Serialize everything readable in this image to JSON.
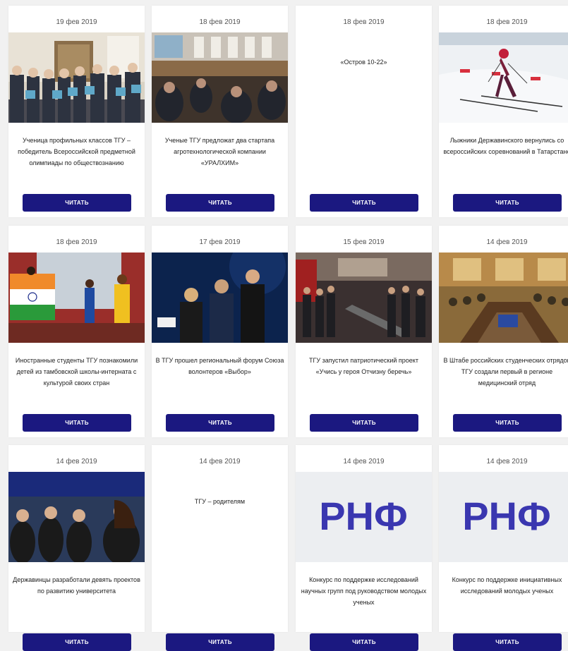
{
  "read_label": "ЧИТАТЬ",
  "cards": [
    {
      "date": "19 фев 2019",
      "title": "Ученица профильных классов ТГУ – победитель Всероссийской предметной олимпиады по обществознанию",
      "image": "students-award-photo"
    },
    {
      "date": "18 фев 2019",
      "title": "Ученые ТГУ предложат два стартапа агротехнологической компании «УРАЛХИМ»",
      "image": "conference-hall-photo"
    },
    {
      "date": "18 фев 2019",
      "title": "«Остров 10-22»",
      "image": ""
    },
    {
      "date": "18 фев 2019",
      "title": "Лыжники Державинского вернулись со всероссийских соревнований в Татарстане",
      "image": "skier-photo"
    },
    {
      "date": "18 фев 2019",
      "title": "Иностранные студенты ТГУ познакомили детей из тамбовской школы-интерната с культурой своих стран",
      "image": "india-flag-performance-photo"
    },
    {
      "date": "17 фев 2019",
      "title": "В ТГУ прошел региональный форум Союза волонтеров «Выбор»",
      "image": "forum-stage-photo"
    },
    {
      "date": "15 фев 2019",
      "title": "ТГУ запустил патриотический проект «Учись у героя Отчизну беречь»",
      "image": "museum-visit-photo"
    },
    {
      "date": "14 фев 2019",
      "title": "В Штабе российских студенческих отрядов ТГУ создали первый в регионе медицинский отряд",
      "image": "meeting-room-photo"
    },
    {
      "date": "14 фев 2019",
      "title": "Державинцы разработали девять проектов по развитию университета",
      "image": "audience-photo"
    },
    {
      "date": "14 фев 2019",
      "title": "ТГУ – родителям",
      "image": ""
    },
    {
      "date": "14 фев 2019",
      "title": "Конкурс по поддержке исследований научных групп под руководством молодых ученых",
      "image": "rnf-logo",
      "logo_text": "РНФ"
    },
    {
      "date": "14 фев 2019",
      "title": "Конкурс по поддержке инициативных исследований молодых ученых",
      "image": "rnf-logo",
      "logo_text": "РНФ"
    }
  ]
}
